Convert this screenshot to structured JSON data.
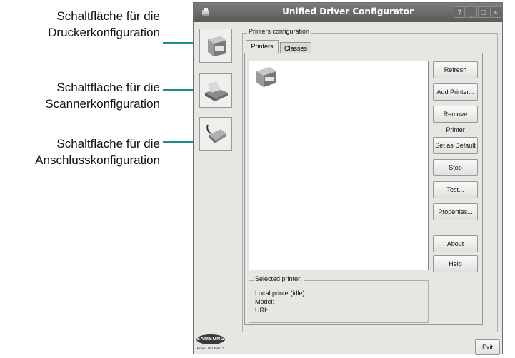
{
  "callouts": [
    {
      "line1": "Schaltfläche für die",
      "line2": "Druckerkonfiguration"
    },
    {
      "line1": "Schaltfläche für die",
      "line2": "Scannerkonfiguration"
    },
    {
      "line1": "Schaltfläche für die",
      "line2": "Anschlusskonfiguration"
    }
  ],
  "window": {
    "title": "Unified Driver Configurator",
    "controls": {
      "help": "?",
      "minimize": "_",
      "maximize": "□",
      "close": "×"
    }
  },
  "sidebar": {
    "items": [
      {
        "name": "printer",
        "icon": "printer-icon"
      },
      {
        "name": "scanner",
        "icon": "scanner-icon"
      },
      {
        "name": "port",
        "icon": "port-icon"
      }
    ]
  },
  "main": {
    "group_label": "Printers configuration",
    "tabs": [
      {
        "label": "Printers",
        "active": true
      },
      {
        "label": "Classes",
        "active": false
      }
    ],
    "printer_list": [
      {
        "icon": "printer-icon"
      }
    ],
    "buttons": {
      "refresh": "Refresh",
      "add_printer": "Add Printer...",
      "remove_printer": "Remove Printer",
      "set_default": "Set as Default",
      "stop": "Stop",
      "test": "Test...",
      "properties": "Properties...",
      "about": "About",
      "help": "Help"
    },
    "selected_printer": {
      "label": "Selected printer:",
      "status": "Local printer(idle)",
      "model": "Model:",
      "uri": "URI:"
    }
  },
  "footer": {
    "exit": "Exit",
    "brand": "SAMSUNG",
    "brand_sub": "ELECTRONICS"
  },
  "colors": {
    "accent": "#1c8f8a",
    "titlebar": "#6a6866",
    "window_bg": "#e8e6e3"
  }
}
